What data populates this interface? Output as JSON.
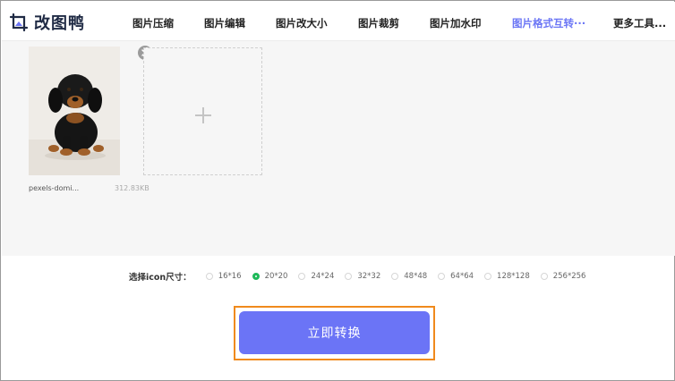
{
  "app": {
    "name": "改图鸭",
    "logo_icon": "image-crop-logo-icon"
  },
  "nav": {
    "items": [
      {
        "label": "图片压缩",
        "active": false
      },
      {
        "label": "图片编辑",
        "active": false
      },
      {
        "label": "图片改大小",
        "active": false
      },
      {
        "label": "图片裁剪",
        "active": false
      },
      {
        "label": "图片加水印",
        "active": false
      },
      {
        "label": "图片格式互转···",
        "active": true
      },
      {
        "label": "更多工具...",
        "active": false
      }
    ]
  },
  "files": [
    {
      "name": "pexels-domi...",
      "size": "312.83KB",
      "thumbnail": "puppy-photo"
    }
  ],
  "upload": {
    "add_icon": "plus-icon"
  },
  "icon_size": {
    "label": "选择icon尺寸：",
    "selected": "20*20",
    "options": [
      "16*16",
      "20*20",
      "24*24",
      "32*32",
      "48*48",
      "64*64",
      "128*128",
      "256*256"
    ]
  },
  "convert_button": {
    "label": "立即转换"
  },
  "colors": {
    "accent": "#6b74f6",
    "nav_active": "#6b76f5",
    "radio_checked": "#1fba5a",
    "highlight_outline": "#f08a1c"
  }
}
